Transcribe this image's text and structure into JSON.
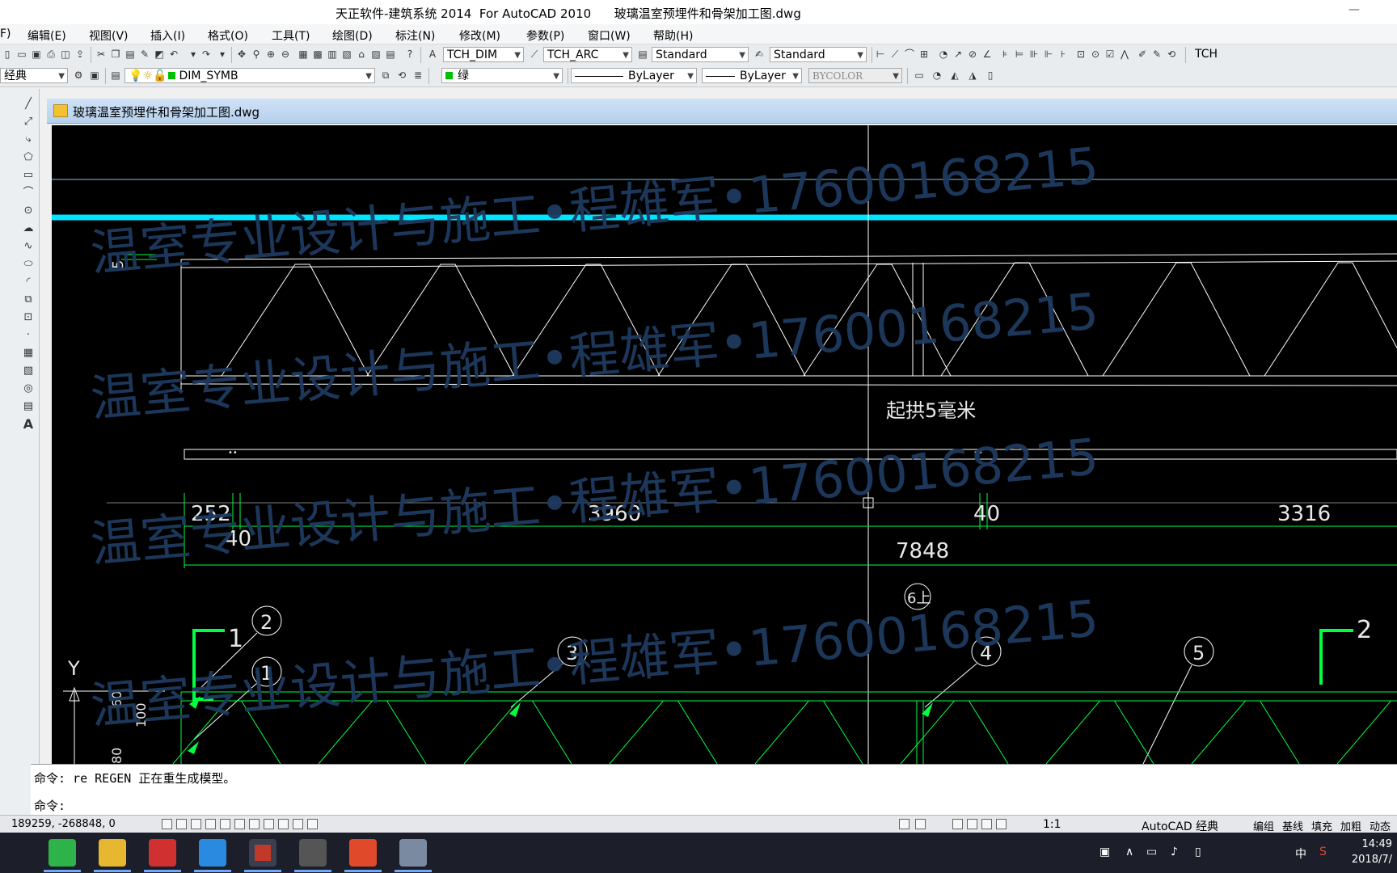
{
  "window": {
    "title": "天正软件-建筑系统 2014  For AutoCAD 2010      玻璃温室预埋件和骨架加工图.dwg",
    "controls": [
      "—",
      "▢",
      "✕"
    ]
  },
  "menu": {
    "items": [
      "F)",
      "编辑(E)",
      "视图(V)",
      "插入(I)",
      "格式(O)",
      "工具(T)",
      "绘图(D)",
      "标注(N)",
      "修改(M)",
      "参数(P)",
      "窗口(W)",
      "帮助(H)"
    ]
  },
  "toolbar1": {
    "dimstyle": "TCH_DIM",
    "arcstyle": "TCH_ARC",
    "textstyle": "Standard",
    "tablestyle": "Standard",
    "right_label": "TCH"
  },
  "toolbar2": {
    "workspace": "经典",
    "layer": "DIM_SYMB",
    "color": "绿",
    "linetype": "ByLayer",
    "lineweight": "ByLayer",
    "plotstyle": "BYCOLOR",
    "color_swatch": "#00c000"
  },
  "drawing": {
    "tab_title": "玻璃温室预埋件和骨架加工图.dwg",
    "watermark": "温室专业设计与施工•程雄军•17600168215",
    "annotations": {
      "camber_dim": "5",
      "camber_note": "起拱5毫米",
      "dim_252": "252",
      "dim_3960": "3960",
      "dim_40_left": "40",
      "dim_40_right": "40",
      "dim_3316": "3316",
      "dim_7848": "7848",
      "gear_label": "6上",
      "section_1": "1",
      "section_2": "2",
      "callout_1": "1",
      "callout_2": "2",
      "callout_3": "3",
      "callout_4": "4",
      "callout_5": "5",
      "axis_y": "Y",
      "left_dims": [
        "60",
        "100",
        "80"
      ]
    },
    "colors": {
      "background": "#000000",
      "line": "#ffffff",
      "cyan": "#00e5ff",
      "green": "#00ff40",
      "watermark": "#1e3a5f"
    }
  },
  "command": {
    "line1": "命令: re REGEN 正在重生成模型。",
    "prompt": "命令:"
  },
  "status": {
    "coords": "189259, -268848, 0",
    "scale": "1:1",
    "workspace": "AutoCAD 经典",
    "right_buttons": [
      "编组",
      "基线",
      "填充",
      "加粗",
      "动态"
    ]
  },
  "taskbar": {
    "time": "14:49",
    "date": "2018/7/",
    "ime": "中",
    "apps": [
      "wechat",
      "file-explorer",
      "media-player",
      "writer",
      "autocad",
      "photos",
      "wps",
      "remote"
    ]
  }
}
